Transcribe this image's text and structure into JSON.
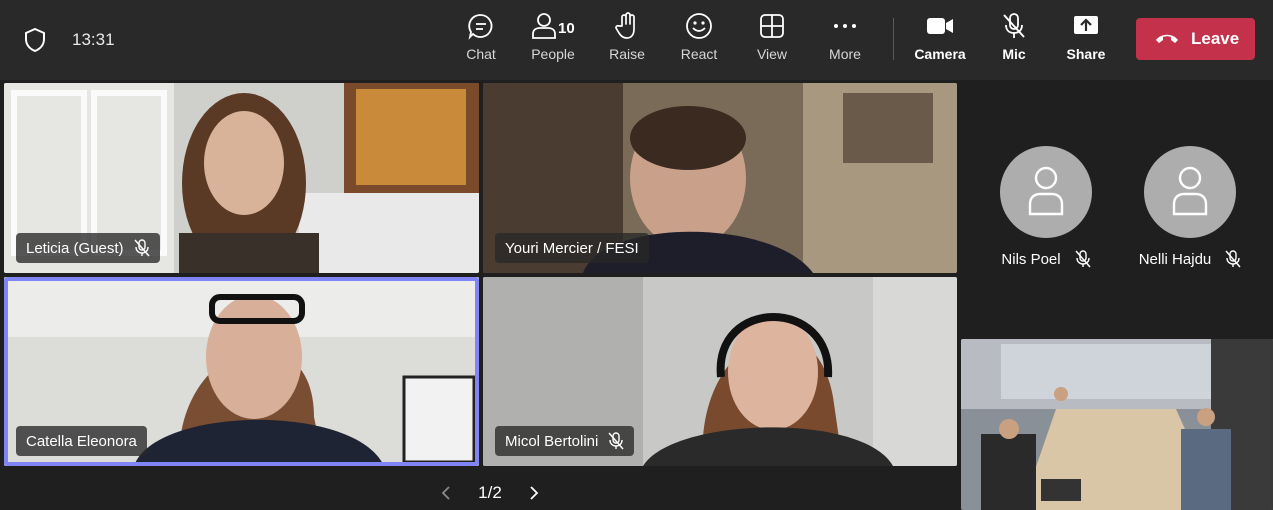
{
  "topbar": {
    "time": "13:31",
    "buttons": {
      "chat": "Chat",
      "people": "People",
      "people_count": "10",
      "raise": "Raise",
      "react": "React",
      "view": "View",
      "more": "More",
      "camera": "Camera",
      "mic": "Mic",
      "share": "Share"
    },
    "leave_label": "Leave"
  },
  "participants": [
    {
      "name": "Leticia (Guest)",
      "muted": true
    },
    {
      "name": "Youri Mercier / FESI",
      "muted": false
    },
    {
      "name": "Catella Eleonora",
      "muted": false,
      "speaking": true
    },
    {
      "name": "Micol Bertolini",
      "muted": true
    }
  ],
  "audio_only": [
    {
      "name": "Nils Poel",
      "muted": true
    },
    {
      "name": "Nelli Hajdu",
      "muted": true
    }
  ],
  "pager": {
    "label": "1/2"
  },
  "colors": {
    "leave": "#c4314b",
    "speaking_ring": "#7f85f5",
    "bar": "#292929",
    "stage": "#1f1f1f"
  }
}
